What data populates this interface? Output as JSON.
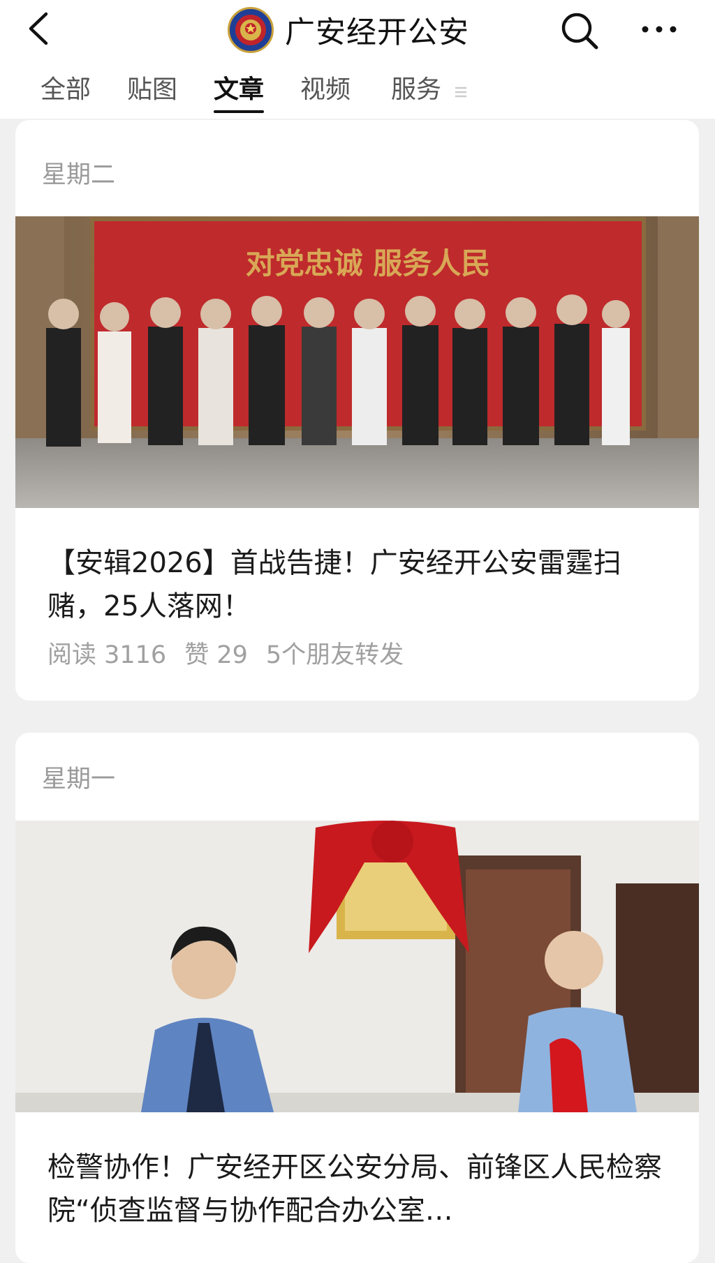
{
  "header": {
    "account_name": "广安经开公安",
    "back_icon": "chevron-left-icon",
    "search_icon": "search-icon",
    "more_icon": "more-dots-icon"
  },
  "tabs": [
    {
      "label": "全部",
      "active": false
    },
    {
      "label": "贴图",
      "active": false
    },
    {
      "label": "文章",
      "active": true
    },
    {
      "label": "视频",
      "active": false
    },
    {
      "label": "服务",
      "active": false
    }
  ],
  "articles": [
    {
      "day": "星期二",
      "photo_banner": "对党忠诚 服务人民",
      "title": "【安辑2026】首战告捷！广安经开公安雷霆扫赌，25人落网！",
      "stats": {
        "reads": "阅读 3116",
        "likes": "赞 29",
        "shares": "5个朋友转发"
      }
    },
    {
      "day": "星期一",
      "title": "检警协作！广安经开区公安分局、前锋区人民检察院“侦查监督与协作配合办公室…"
    }
  ],
  "colors": {
    "accent": "#111111",
    "muted": "#9a9a9a",
    "banner_red": "#c0242b",
    "police_blue": "#1f3f96"
  }
}
